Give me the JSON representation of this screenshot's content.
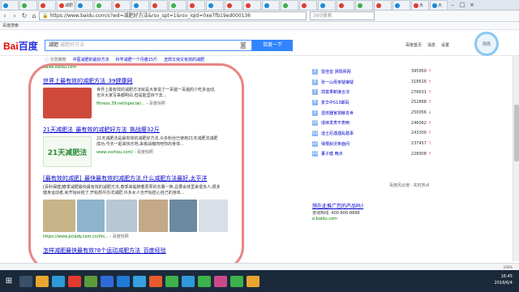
{
  "browser": {
    "tabs": [
      {
        "label": "",
        "color": "#1a8ad8",
        "active": false
      },
      {
        "label": "",
        "color": "#3db14b",
        "active": false
      },
      {
        "label": "",
        "color": "#e23a2e",
        "active": false
      },
      {
        "label": "减肥",
        "color": "#e23a2e",
        "active": true
      },
      {
        "label": "",
        "color": "#1a8ad8",
        "active": false
      },
      {
        "label": "",
        "color": "#3db14b",
        "active": false
      },
      {
        "label": "",
        "color": "#e23a2e",
        "active": false
      },
      {
        "label": "",
        "color": "#1a8ad8",
        "active": false
      },
      {
        "label": "",
        "color": "#e23a2e",
        "active": false
      },
      {
        "label": "",
        "color": "#3db14b",
        "active": false
      },
      {
        "label": "",
        "color": "#e23a2e",
        "active": false
      },
      {
        "label": "",
        "color": "#1a8ad8",
        "active": false
      },
      {
        "label": "",
        "color": "#e23a2e",
        "active": false
      },
      {
        "label": "",
        "color": "#e23a2e",
        "active": false
      },
      {
        "label": "",
        "color": "#1a8ad8",
        "active": false
      },
      {
        "label": "",
        "color": "#3db14b",
        "active": false
      },
      {
        "label": "",
        "color": "#e23a2e",
        "active": false
      },
      {
        "label": "",
        "color": "#1a8ad8",
        "active": false
      },
      {
        "label": "",
        "color": "#e23a2e",
        "active": false
      },
      {
        "label": "",
        "color": "#3db14b",
        "active": false
      },
      {
        "label": "",
        "color": "#e23a2e",
        "active": false
      },
      {
        "label": "",
        "color": "#1a8ad8",
        "active": false
      },
      {
        "label": "大",
        "color": "#e23a2e",
        "active": false
      },
      {
        "label": "大",
        "color": "#1a8ad8",
        "active": false
      }
    ],
    "url": "https://www.baidu.com/s?wd=减肥好方法&rsv_spt=1&rsv_iqid=0xe7fb19ed000136",
    "side_search_placeholder": "360搜索",
    "bookmark": "百度搜索"
  },
  "baidu": {
    "logo_a": "Bai",
    "logo_b": "百度",
    "query": "减肥",
    "query_hint": "减肥好方法",
    "search_button": "百度一下",
    "toplinks": [
      "百度首页",
      "消息",
      "设置"
    ],
    "user": "周周"
  },
  "tip": {
    "label": "为您推荐",
    "links": [
      "中医减肥的最好方法",
      "科学减肥一个月瘦15斤",
      "怎样又快又有效的减肥"
    ]
  },
  "results": {
    "top_source": "baike.baidu.com",
    "items": [
      {
        "title": "世界上最有效的减肥方法_39健康网",
        "text": "世界上最有效的减肥方法就是大家说了一百遍一百遍的少吃多运动,也许大家写来都明白,但是能坚持下去...",
        "source": "fitness.39.net/special/...",
        "snapshot": "百度快照",
        "thumb": "#d04a3c"
      },
      {
        "title": "21天减肥法_最有效的减肥好方法_挑战瘦32斤",
        "text": "21天减肥法是最有效的减肥好方法,众多粉丝已使用21天减肥法减肥成功,今天一起来快乐地,来挑战瘦肉吧你的身体...",
        "source": "www.vsshou.com/",
        "snapshot": "百度快照",
        "thumb": "#2e8b3a",
        "thumb_text": "21天减肥法"
      },
      {
        "title": "[最有效的减肥]_最快最有效的减肥方法,什么减肥方法最好,太平洋",
        "desc": "[百科保健]春季减肥最快最有效的减肥方法,春季来临随着厚厚的衣服一换,总要会体里来很多人,很多健身运动者,就开始纠结了,开始想尽办法减肥,许多女人也开始担心自己的身体...",
        "source": "https://www.pclady.com.cn/tlis...",
        "snapshot": "百度快照",
        "images": [
          "#c9b48a",
          "#8fb3cc",
          "#b7c7d4",
          "#c4a88a",
          "#6b8aa0",
          "#d8dfe6"
        ]
      },
      {
        "title": "怎样减肥最快最有效?8个运动减肥方法_百度经验"
      }
    ]
  },
  "hotlist": {
    "rows": [
      {
        "rank": "5",
        "name": "雷佳音 阴阳师网",
        "value": "395950",
        "trend": "up"
      },
      {
        "rank": "6",
        "name": "张一山母亲疑嫌疑",
        "value": "318616",
        "trend": "up"
      },
      {
        "rank": "7",
        "name": "郭富果断接合法",
        "value": "276631",
        "trend": "up"
      },
      {
        "rank": "8",
        "name": "复华中513邮码",
        "value": "252868",
        "trend": "up"
      },
      {
        "rank": "9",
        "name": "遗体器官捐献去世",
        "value": "250056",
        "trend": "down"
      },
      {
        "rank": "10",
        "name": "成续发表不表两",
        "value": "246062",
        "trend": "up"
      },
      {
        "rank": "11",
        "name": "迪士尼遇遇乱踏事",
        "value": "243300",
        "trend": "up"
      },
      {
        "rank": "12",
        "name": "保根斜沃条面间",
        "value": "237457",
        "trend": "up"
      },
      {
        "rank": "13",
        "name": "董子健 晚点",
        "value": "228908",
        "trend": "up"
      }
    ],
    "footer": "百度风云榜 · 实时热点"
  },
  "ad": {
    "title": "想在此推广您的产品吗?",
    "phone": "咨询热线: 400-800-8888",
    "url": "e.baidu.com"
  },
  "statusbar": {
    "zoom": "100%"
  },
  "taskbar": {
    "apps": [
      {
        "icon": "task-view-icon",
        "color": "#3a5068"
      },
      {
        "icon": "explorer-icon",
        "color": "#e8a530"
      },
      {
        "icon": "360-browser-icon",
        "color": "#2f9ad8"
      },
      {
        "icon": "media-icon",
        "color": "#e23a2e"
      },
      {
        "icon": "photo-icon",
        "color": "#5e9b3a"
      },
      {
        "icon": "store-icon",
        "color": "#2f6bd8"
      },
      {
        "icon": "kugou-icon",
        "color": "#1f7ad8"
      },
      {
        "icon": "qq-icon",
        "color": "#35a1e0"
      },
      {
        "icon": "sogou-icon",
        "color": "#e85a2e"
      },
      {
        "icon": "wechat-icon",
        "color": "#3db14b"
      },
      {
        "icon": "browser-icon",
        "color": "#2f9ad8"
      },
      {
        "icon": "editor-icon",
        "color": "#3db14b"
      },
      {
        "icon": "tool-icon",
        "color": "#c94a8a"
      },
      {
        "icon": "app-icon",
        "color": "#3db14b"
      },
      {
        "icon": "app2-icon",
        "color": "#e8a530"
      }
    ],
    "time": "16:45",
    "date": "2018/6/4"
  }
}
